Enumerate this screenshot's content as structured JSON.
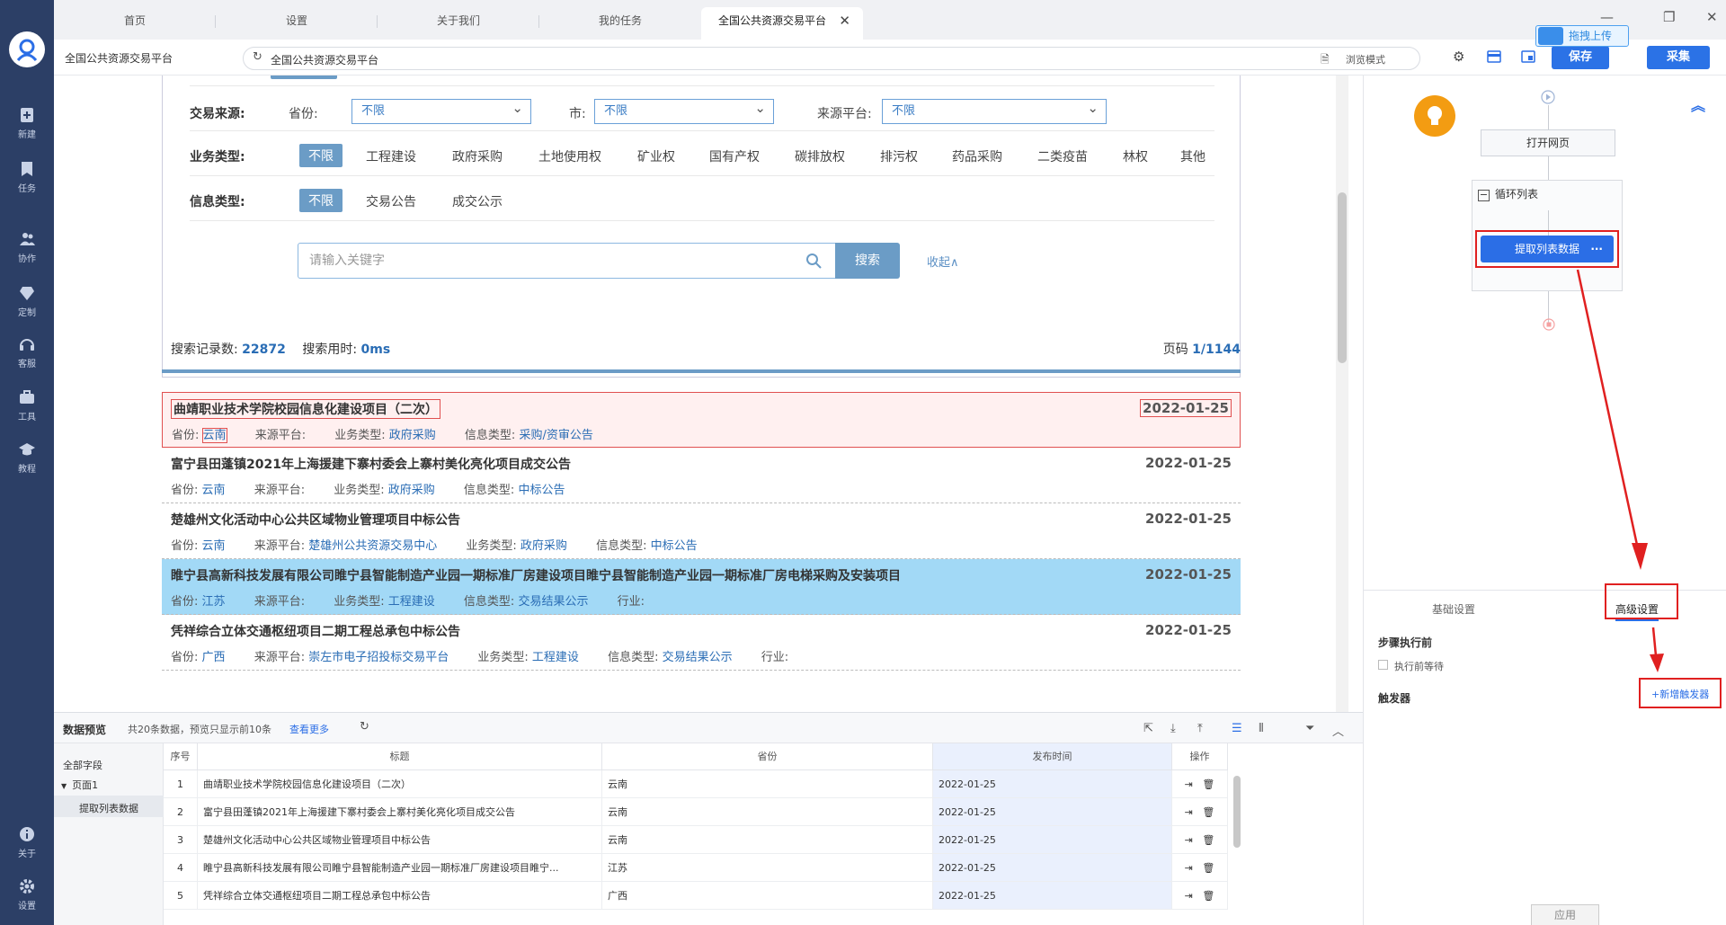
{
  "tabs": [
    "首页",
    "设置",
    "关于我们",
    "我的任务",
    "全国公共资源交易平台"
  ],
  "sidebar": [
    {
      "label": "新建",
      "icon": "plus-doc-icon"
    },
    {
      "label": "任务",
      "icon": "bookmark-icon"
    },
    {
      "label": "协作",
      "icon": "people-icon"
    },
    {
      "label": "定制",
      "icon": "diamond-icon"
    },
    {
      "label": "客服",
      "icon": "headset-icon"
    },
    {
      "label": "工具",
      "icon": "toolbox-icon"
    },
    {
      "label": "教程",
      "icon": "graduation-cap-icon"
    },
    {
      "label": "关于",
      "icon": "info-icon"
    },
    {
      "label": "设置",
      "icon": "gear-icon"
    }
  ],
  "address": {
    "site_name": "全国公共资源交易平台",
    "url": "全国公共资源交易平台",
    "browse_mode": "浏览模式"
  },
  "toolbar": {
    "save": "保存",
    "collect": "采集",
    "upload": "拖拽上传"
  },
  "filters": {
    "source_label": "交易来源:",
    "province_label": "省份:",
    "province_value": "不限",
    "city_label": "市:",
    "city_value": "不限",
    "platform_label": "来源平台:",
    "platform_value": "不限",
    "biz_label": "业务类型:",
    "biz_options": [
      "不限",
      "工程建设",
      "政府采购",
      "土地使用权",
      "矿业权",
      "国有产权",
      "碳排放权",
      "排污权",
      "药品采购",
      "二类疫苗",
      "林权",
      "其他"
    ],
    "info_label": "信息类型:",
    "info_options": [
      "不限",
      "交易公告",
      "成交公示"
    ],
    "search_placeholder": "请输入关键字",
    "search_button": "搜索",
    "collapse": "收起∧"
  },
  "stats": {
    "count_label": "搜索记录数:",
    "count": "22872",
    "time_label": "搜索用时:",
    "time": "0ms",
    "page_label": "页码",
    "page": "1/1144"
  },
  "records": [
    {
      "title": "曲靖职业技术学院校园信息化建设项目（二次）",
      "date": "2022-01-25",
      "meta": [
        [
          "省份:",
          "云南"
        ],
        [
          "来源平台:",
          ""
        ],
        [
          "业务类型:",
          "政府采购"
        ],
        [
          "信息类型:",
          "采购/资审公告"
        ]
      ]
    },
    {
      "title": "富宁县田蓬镇2021年上海援建下寨村委会上寨村美化亮化项目成交公告",
      "date": "2022-01-25",
      "meta": [
        [
          "省份:",
          "云南"
        ],
        [
          "来源平台:",
          ""
        ],
        [
          "业务类型:",
          "政府采购"
        ],
        [
          "信息类型:",
          "中标公告"
        ]
      ]
    },
    {
      "title": "楚雄州文化活动中心公共区域物业管理项目中标公告",
      "date": "2022-01-25",
      "meta": [
        [
          "省份:",
          "云南"
        ],
        [
          "来源平台:",
          "楚雄州公共资源交易中心"
        ],
        [
          "业务类型:",
          "政府采购"
        ],
        [
          "信息类型:",
          "中标公告"
        ]
      ]
    },
    {
      "title": "睢宁县高新科技发展有限公司睢宁县智能制造产业园一期标准厂房建设项目睢宁县智能制造产业园一期标准厂房电梯采购及安装项目",
      "date": "2022-01-25",
      "meta": [
        [
          "省份:",
          "江苏"
        ],
        [
          "来源平台:",
          ""
        ],
        [
          "业务类型:",
          "工程建设"
        ],
        [
          "信息类型:",
          "交易结果公示"
        ],
        [
          "行业:",
          ""
        ]
      ]
    },
    {
      "title": "凭祥综合立体交通枢纽项目二期工程总承包中标公告",
      "date": "2022-01-25",
      "meta": [
        [
          "省份:",
          "广西"
        ],
        [
          "来源平台:",
          "崇左市电子招投标交易平台"
        ],
        [
          "业务类型:",
          "工程建设"
        ],
        [
          "信息类型:",
          "交易结果公示"
        ],
        [
          "行业:",
          ""
        ]
      ]
    }
  ],
  "flow": {
    "open_page": "打开网页",
    "loop": "循环列表",
    "extract": "提取列表数据"
  },
  "right_tabs": {
    "basic": "基础设置",
    "advanced": "高级设置"
  },
  "advanced": {
    "before_step": "步骤执行前",
    "wait_before": "执行前等待",
    "trigger": "触发器",
    "add_trigger": "+新增触发器",
    "apply": "应用"
  },
  "preview": {
    "title": "数据预览",
    "info": "共20条数据，预览只显示前10条",
    "more": "查看更多",
    "tree": {
      "all": "全部字段",
      "page": "页面1",
      "extract": "提取列表数据"
    },
    "columns": [
      "序号",
      "标题",
      "省份",
      "发布时间",
      "操作"
    ],
    "rows": [
      [
        "1",
        "曲靖职业技术学院校园信息化建设项目（二次）",
        "云南",
        "2022-01-25"
      ],
      [
        "2",
        "富宁县田蓬镇2021年上海援建下寨村委会上寨村美化亮化项目成交公告",
        "云南",
        "2022-01-25"
      ],
      [
        "3",
        "楚雄州文化活动中心公共区域物业管理项目中标公告",
        "云南",
        "2022-01-25"
      ],
      [
        "4",
        "睢宁县高新科技发展有限公司睢宁县智能制造产业园一期标准厂房建设项目睢宁...",
        "江苏",
        "2022-01-25"
      ],
      [
        "5",
        "凭祥综合立体交通枢纽项目二期工程总承包中标公告",
        "广西",
        "2022-01-25"
      ]
    ]
  }
}
